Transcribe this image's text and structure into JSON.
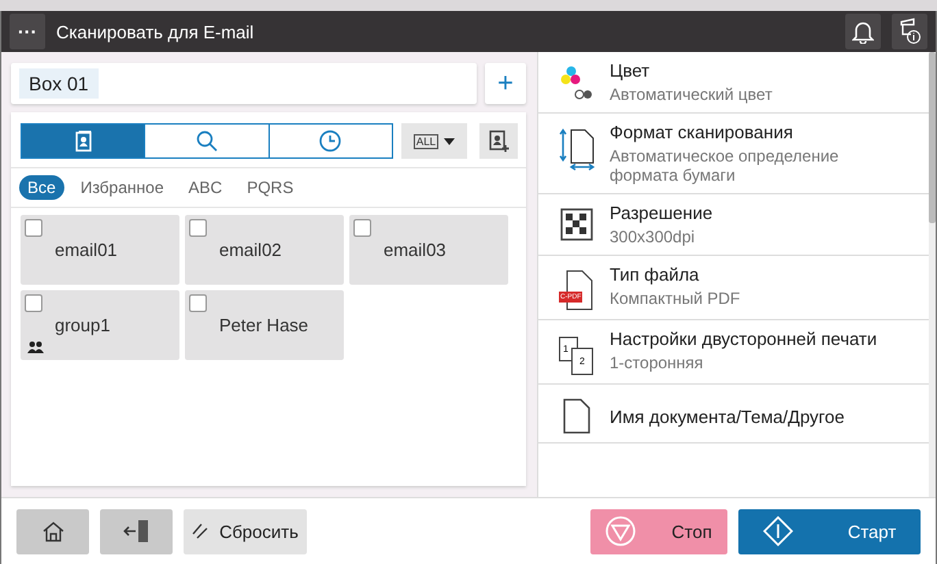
{
  "title_bar": {
    "menu_label": "···",
    "title": "Сканировать для E-mail"
  },
  "box_field": {
    "value": "Box 01",
    "add_label": "+"
  },
  "view_tabs": [
    {
      "kind": "addressbook",
      "selected": true
    },
    {
      "kind": "search",
      "selected": false
    },
    {
      "kind": "history",
      "selected": false
    }
  ],
  "type_filter": {
    "label": "ALL"
  },
  "index_tabs": [
    {
      "label": "Все",
      "selected": true
    },
    {
      "label": "Избранное",
      "selected": false
    },
    {
      "label": "ABC",
      "selected": false
    },
    {
      "label": "PQRS",
      "selected": false
    }
  ],
  "contacts": [
    {
      "name": "email01",
      "kind": "email",
      "checked": false
    },
    {
      "name": "email02",
      "kind": "email",
      "checked": false
    },
    {
      "name": "email03",
      "kind": "email",
      "checked": false
    },
    {
      "name": "group1",
      "kind": "group",
      "checked": false
    },
    {
      "name": "Peter Hase",
      "kind": "email",
      "checked": false
    }
  ],
  "settings": [
    {
      "kind": "color",
      "title": "Цвет",
      "value": "Автоматический цвет"
    },
    {
      "kind": "size",
      "title": "Формат сканирования",
      "value": "Автоматическое определение формата бумаги"
    },
    {
      "kind": "resolution",
      "title": "Разрешение",
      "value": "300x300dpi"
    },
    {
      "kind": "filetype",
      "title": "Тип файла",
      "value": "Компактный PDF",
      "badge": "C-PDF"
    },
    {
      "kind": "duplex",
      "title": "Настройки двусторонней печати",
      "value": "1-сторонняя",
      "page_numbers": [
        "1",
        "2"
      ]
    },
    {
      "kind": "document",
      "title": "Имя документа/Тема/Другое"
    }
  ],
  "bottom_bar": {
    "reset_label": "Сбросить",
    "stop_label": "Стоп",
    "start_label": "Старт"
  }
}
